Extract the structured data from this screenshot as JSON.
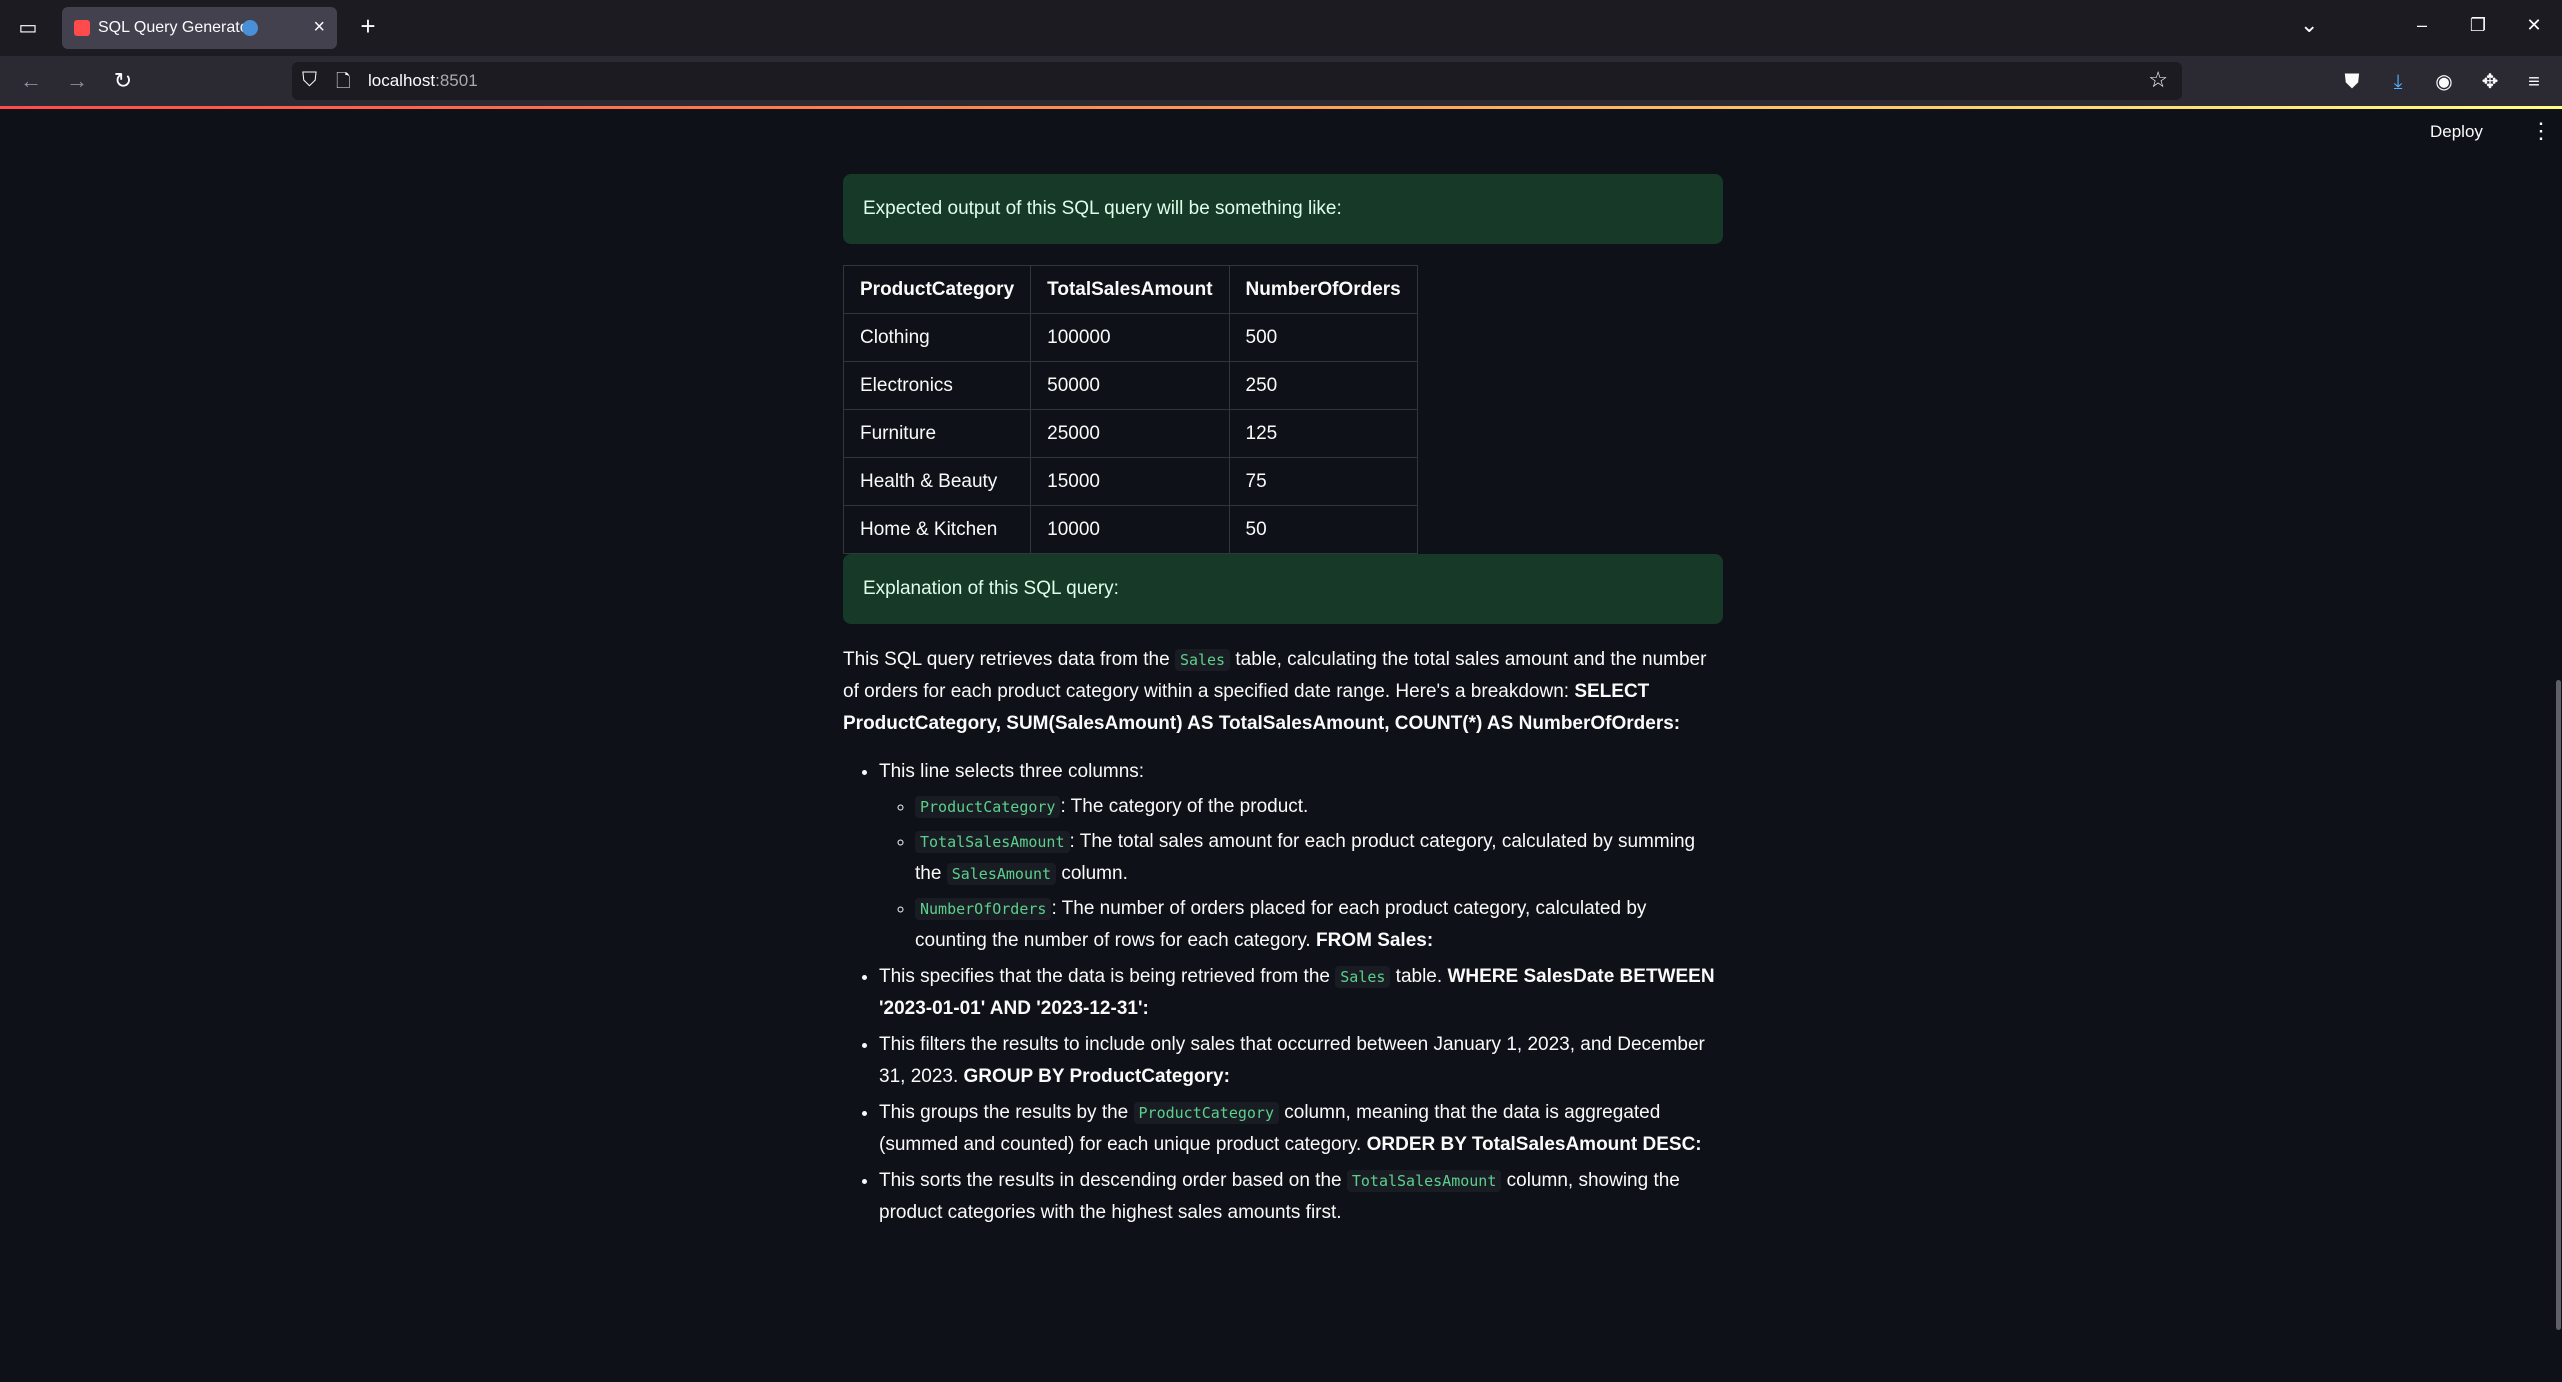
{
  "browser": {
    "tab_title": "SQL Query Generator",
    "url_host": "localhost",
    "url_port": ":8501",
    "icons": [
      "tab-list-icon",
      "streamlit-favicon",
      "globe-icon",
      "close-icon",
      "plus-icon",
      "chevron-down-icon",
      "minimize-icon",
      "restore-icon",
      "close-window-icon",
      "back-arrow-icon",
      "forward-arrow-icon",
      "reload-icon",
      "shield-icon",
      "page-icon",
      "star-icon",
      "pocket-icon",
      "download-icon",
      "account-icon",
      "extensions-icon",
      "menu-icon"
    ]
  },
  "header": {
    "deploy_label": "Deploy",
    "menu_glyph": "⋮"
  },
  "output_box": {
    "text": "Expected output of this SQL query will be something like:"
  },
  "result_table": {
    "columns": [
      "ProductCategory",
      "TotalSalesAmount",
      "NumberOfOrders"
    ],
    "rows": [
      [
        "Clothing",
        "100000",
        "500"
      ],
      [
        "Electronics",
        "50000",
        "250"
      ],
      [
        "Furniture",
        "25000",
        "125"
      ],
      [
        "Health & Beauty",
        "15000",
        "75"
      ],
      [
        "Home & Kitchen",
        "10000",
        "50"
      ]
    ]
  },
  "explanation_box": {
    "text": "Explanation of this SQL query:"
  },
  "explanation": {
    "intro_1": "This SQL query retrieves data from the ",
    "intro_code": "Sales",
    "intro_2": " table, calculating the total sales amount and the number of orders for each product category within a specified date range. Here's a breakdown: ",
    "intro_bold": "SELECT ProductCategory, SUM(SalesAmount) AS TotalSalesAmount, COUNT(*) AS NumberOfOrders:",
    "b1_text": "This line selects three columns:",
    "s1_code": "ProductCategory",
    "s1_text": ": The category of the product.",
    "s2_code": "TotalSalesAmount",
    "s2_text": ": The total sales amount for each product category, calculated by summing the ",
    "s2_code2": "SalesAmount",
    "s2_text2": " column.",
    "s3_code": "NumberOfOrders",
    "s3_text": ": The number of orders placed for each product category, calculated by counting the number of rows for each category. ",
    "s3_bold": "FROM Sales:",
    "b2_text": "This specifies that the data is being retrieved from the ",
    "b2_code": "Sales",
    "b2_text2": " table. ",
    "b2_bold": "WHERE SalesDate BETWEEN '2023-01-01' AND '2023-12-31':",
    "b3_text": "This filters the results to include only sales that occurred between January 1, 2023, and December 31, 2023. ",
    "b3_bold": "GROUP BY ProductCategory:",
    "b4_text": "This groups the results by the ",
    "b4_code": "ProductCategory",
    "b4_text2": " column, meaning that the data is aggregated (summed and counted) for each unique product category. ",
    "b4_bold": "ORDER BY TotalSalesAmount DESC:",
    "b5_text": "This sorts the results in descending order based on the ",
    "b5_code": "TotalSalesAmount",
    "b5_text2": " column, showing the product categories with the highest sales amounts first."
  }
}
